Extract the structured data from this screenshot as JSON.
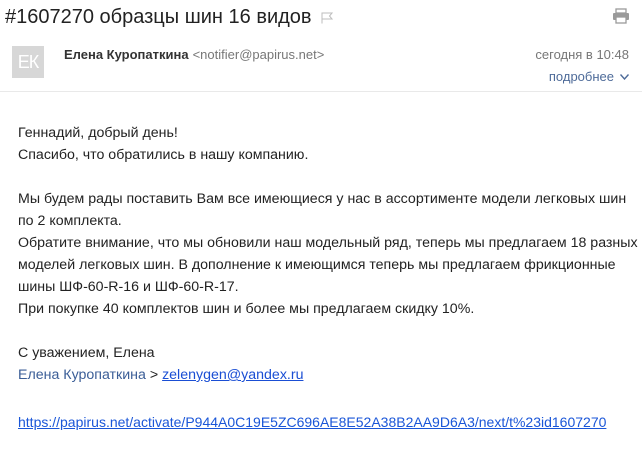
{
  "message": {
    "subject": "#1607270 образцы шин 16 видов",
    "sender": {
      "avatar_initials": "ЕК",
      "name": "Елена Куропаткина",
      "email": "<notifier@papirus.net>"
    },
    "date": "сегодня в 10:48",
    "details_label": "подробнее",
    "body": {
      "greeting": "Геннадий, добрый день!",
      "thanks": "Спасибо, что обратились в нашу компанию.",
      "p1": "Мы будем рады поставить Вам все имеющиеся у нас в ассортименте модели легковых шин по 2 комплекта.",
      "p2": "Обратите внимание, что мы обновили наш модельный ряд, теперь мы предлагаем 18 разных моделей легковых шин. В дополнение к имеющимся теперь мы предлагаем фрикционные шины ШФ-60-R-16 и ШФ-60-R-17.",
      "p3": "При покупке 40 комплектов шин и более мы предлагаем скидку 10%.",
      "regards": "С уважением, Елена"
    },
    "signature": {
      "name": "Елена Куропаткина",
      "separator": " > ",
      "email": "zelenygen@yandex.ru"
    },
    "activate_link": "https://papirus.net/activate/P944A0C19E5ZC696AE8E52A38B2AA9D6A3/next/t%23id1607270"
  },
  "colors": {
    "link": "#1a56d8",
    "details": "#4e6b99",
    "avatar_bg": "#d7d7d7"
  },
  "icons": [
    "flag-icon",
    "print-icon",
    "chevron-down-icon"
  ]
}
